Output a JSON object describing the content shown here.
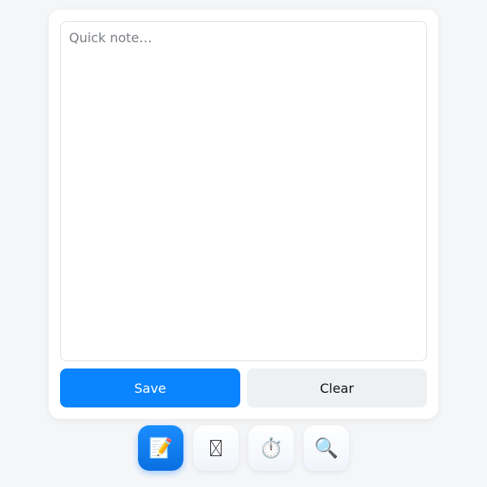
{
  "note": {
    "placeholder": "Quick note…",
    "value": ""
  },
  "actions": {
    "save_label": "Save",
    "clear_label": "Clear"
  },
  "dock": {
    "items": [
      {
        "icon": "memo-icon",
        "glyph": "📝",
        "active": true
      },
      {
        "icon": "hourglass-icon",
        "glyph": "",
        "active": false
      },
      {
        "icon": "stopwatch-icon",
        "glyph": "⏱️",
        "active": false
      },
      {
        "icon": "magnifier-icon",
        "glyph": "🔍",
        "active": false
      }
    ]
  },
  "colors": {
    "accent": "#0a84ff",
    "secondary_button": "#eef1f4",
    "background": "#f5f6f8"
  }
}
